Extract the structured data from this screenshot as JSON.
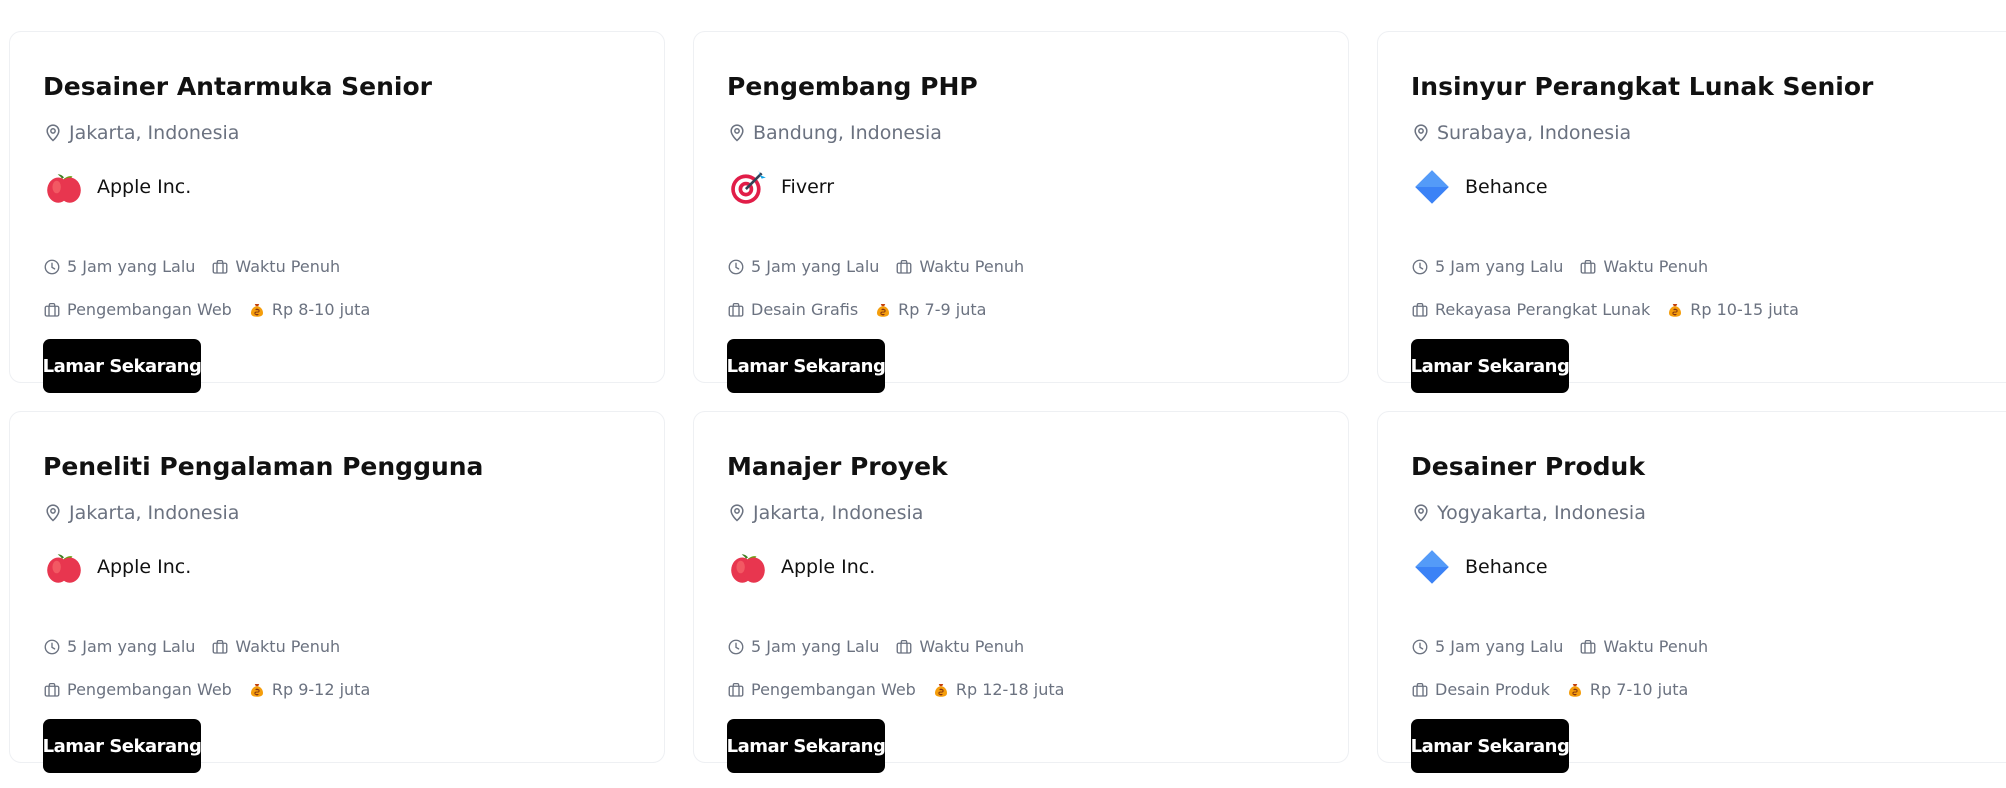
{
  "jobs": [
    {
      "title": "Desainer Antarmuka Senior",
      "location": "Jakarta, Indonesia",
      "company": "Apple Inc.",
      "company_logo": "apple-logo",
      "posted": "5 Jam yang Lalu",
      "job_type": "Waktu Penuh",
      "category": "Pengembangan Web",
      "salary": "Rp 8-10 juta",
      "apply_label": "Lamar Sekarang"
    },
    {
      "title": "Pengembang PHP",
      "location": "Bandung, Indonesia",
      "company": "Fiverr",
      "company_logo": "target-logo",
      "posted": "5 Jam yang Lalu",
      "job_type": "Waktu Penuh",
      "category": "Desain Grafis",
      "salary": "Rp 7-9 juta",
      "apply_label": "Lamar Sekarang"
    },
    {
      "title": "Insinyur Perangkat Lunak Senior",
      "location": "Surabaya, Indonesia",
      "company": "Behance",
      "company_logo": "diamond-logo",
      "posted": "5 Jam yang Lalu",
      "job_type": "Waktu Penuh",
      "category": "Rekayasa Perangkat Lunak",
      "salary": "Rp 10-15 juta",
      "apply_label": "Lamar Sekarang"
    },
    {
      "title": "Peneliti Pengalaman Pengguna",
      "location": "Jakarta, Indonesia",
      "company": "Apple Inc.",
      "company_logo": "apple-logo",
      "posted": "5 Jam yang Lalu",
      "job_type": "Waktu Penuh",
      "category": "Pengembangan Web",
      "salary": "Rp 9-12 juta",
      "apply_label": "Lamar Sekarang"
    },
    {
      "title": "Manajer Proyek",
      "location": "Jakarta, Indonesia",
      "company": "Apple Inc.",
      "company_logo": "apple-logo",
      "posted": "5 Jam yang Lalu",
      "job_type": "Waktu Penuh",
      "category": "Pengembangan Web",
      "salary": "Rp 12-18 juta",
      "apply_label": "Lamar Sekarang"
    },
    {
      "title": "Desainer Produk",
      "location": "Yogyakarta, Indonesia",
      "company": "Behance",
      "company_logo": "diamond-logo",
      "posted": "5 Jam yang Lalu",
      "job_type": "Waktu Penuh",
      "category": "Desain Produk",
      "salary": "Rp 7-10 juta",
      "apply_label": "Lamar Sekarang"
    }
  ],
  "colors": {
    "button_bg": "#000000",
    "button_text": "#ffffff",
    "muted_text": "#6b7280",
    "card_border": "#eef0f3",
    "apple_red": "#e8364f",
    "behance_blue": "#3b82f6",
    "fiverr_target": "#e11d48"
  }
}
